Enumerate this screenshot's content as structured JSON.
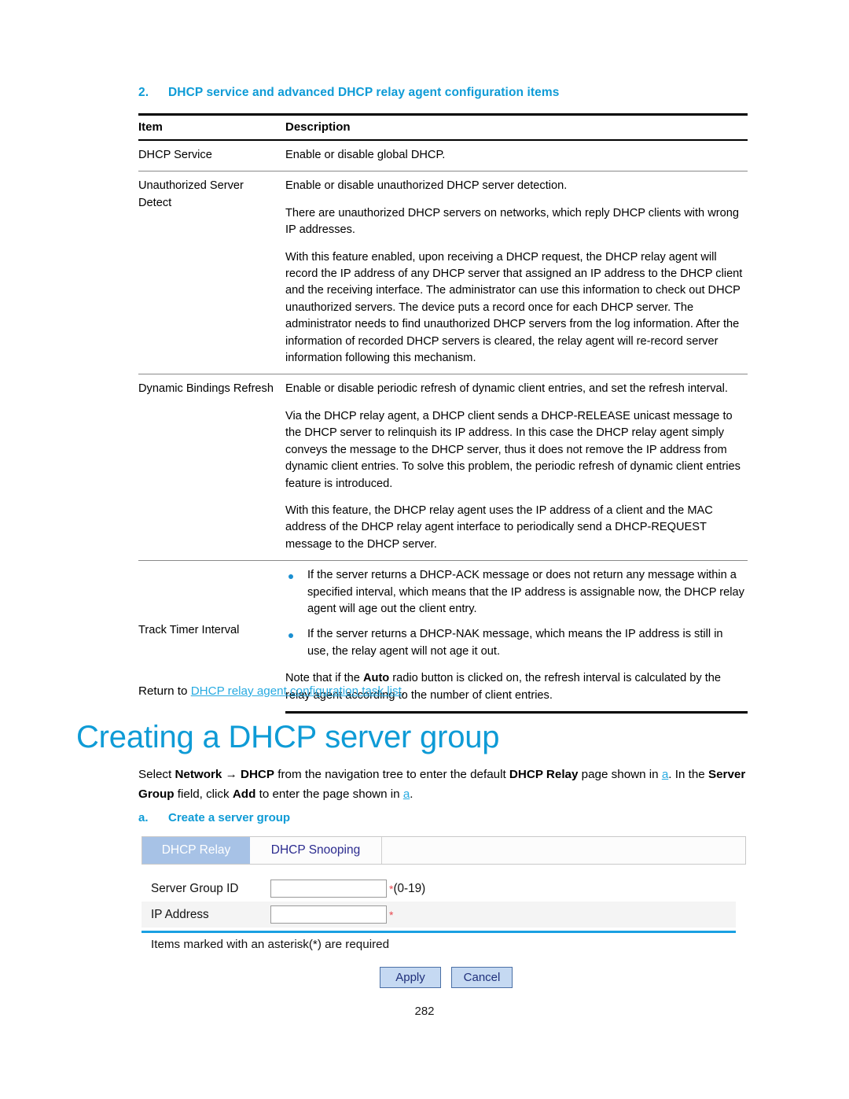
{
  "table": {
    "number": "2.",
    "caption": "DHCP service and advanced DHCP relay agent configuration items",
    "headers": [
      "Item",
      "Description"
    ],
    "rows": [
      {
        "item": "DHCP Service",
        "paragraphs": [
          "Enable or disable global DHCP."
        ]
      },
      {
        "item": "Unauthorized Server Detect",
        "paragraphs": [
          "Enable or disable unauthorized DHCP server detection.",
          "There are unauthorized DHCP servers on networks, which reply DHCP clients with wrong IP addresses.",
          "With this feature enabled, upon receiving a DHCP request, the DHCP relay agent will record the IP address of any DHCP server that assigned an IP address to the DHCP client and the receiving interface. The administrator can use this information to check out DHCP unauthorized servers. The device puts a record once for each DHCP server. The administrator needs to find unauthorized DHCP servers from the log information. After the information of recorded DHCP servers is cleared, the relay agent will re-record server information following this mechanism."
        ]
      },
      {
        "item": "Dynamic Bindings Refresh",
        "paragraphs": [
          "Enable or disable periodic refresh of dynamic client entries, and set the refresh interval.",
          "Via the DHCP relay agent, a DHCP client sends a DHCP-RELEASE unicast message to the DHCP server to relinquish its IP address. In this case the DHCP relay agent simply conveys the message to the DHCP server, thus it does not remove the IP address from dynamic client entries. To solve this problem, the periodic refresh of dynamic client entries feature is introduced.",
          "With this feature, the DHCP relay agent uses the IP address of a client and the MAC address of the DHCP relay agent interface to periodically send a DHCP-REQUEST message to the DHCP server."
        ]
      },
      {
        "item": "Track Timer Interval",
        "bullets": [
          "If the server returns a DHCP-ACK message or does not return any message within a specified interval, which means that the IP address is assignable now, the DHCP relay agent will age out the client entry.",
          "If the server returns a DHCP-NAK message, which means the IP address is still in use, the relay agent will not age it out."
        ],
        "note_prefix": "Note that if the ",
        "note_bold": "Auto",
        "note_suffix": " radio button is clicked on, the refresh interval is calculated by the relay agent according to the number of client entries."
      }
    ]
  },
  "return_line": {
    "prefix": "Return to ",
    "link": "DHCP relay agent configuration task list",
    "suffix": "."
  },
  "heading": "Creating a DHCP server group",
  "select_para": {
    "s1": "Select ",
    "b1": "Network",
    "arrow": " → ",
    "b2": "DHCP",
    "s2": " from the navigation tree to enter the default ",
    "b3": "DHCP Relay",
    "s3": " page shown in ",
    "link1": "a",
    "s4": ". In the ",
    "b4": "Server Group",
    "s5": " field, click ",
    "b5": "Add",
    "s6": " to enter the page shown in ",
    "link2": "a",
    "s7": "."
  },
  "figure": {
    "number": "a.",
    "caption": "Create a server group"
  },
  "app": {
    "tabs": [
      {
        "label": "DHCP Relay",
        "active": true
      },
      {
        "label": "DHCP Snooping",
        "active": false
      }
    ],
    "fields": [
      {
        "label": "Server Group ID",
        "value": "",
        "required_mark": "*",
        "hint": "(0-19)"
      },
      {
        "label": "IP Address",
        "value": "",
        "required_mark": "*",
        "hint": ""
      }
    ],
    "required_note": "Items marked with an asterisk(*) are required",
    "buttons": [
      {
        "label": "Apply"
      },
      {
        "label": "Cancel"
      }
    ],
    "colors": {
      "active_tab": "#a7c2e6",
      "button_bg": "#c5d9f2",
      "accent_rule": "#1aa0e2",
      "required": "#e8484f"
    }
  },
  "page_number": "282",
  "theme": {
    "heading_blue": "#0e9bd6",
    "link_blue": "#27aae1",
    "bullet_blue": "#1a8fd1"
  }
}
